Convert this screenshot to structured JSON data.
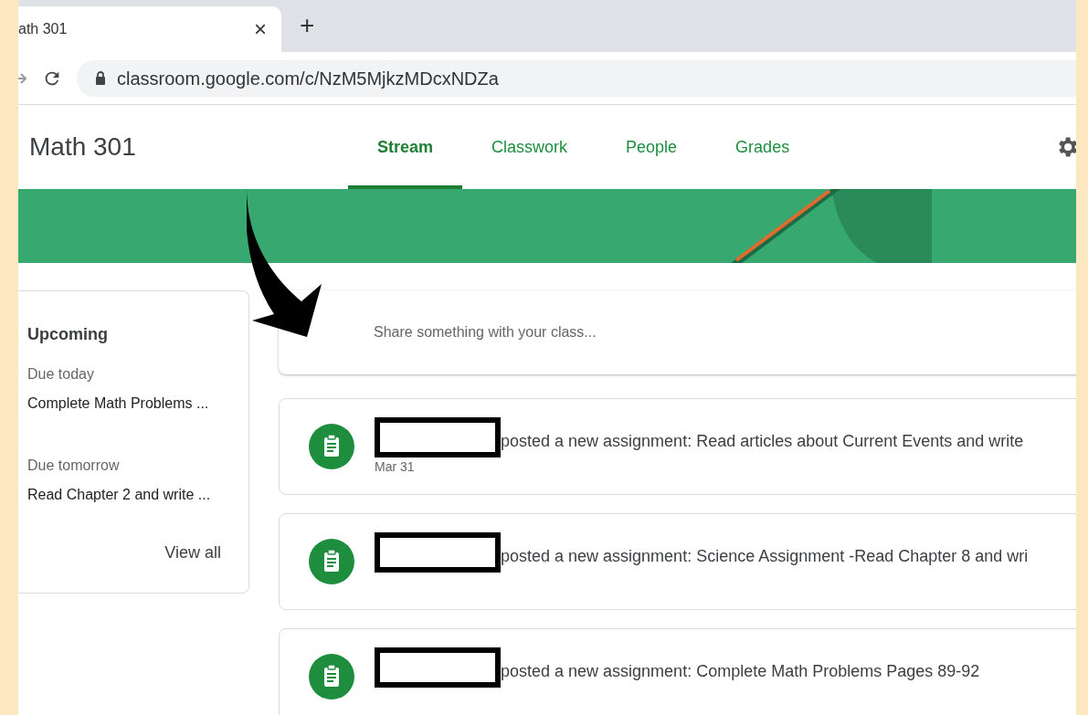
{
  "browser": {
    "tab_title": "ath 301",
    "tab_close": "×",
    "new_tab": "+",
    "url": "classroom.google.com/c/NzM5MjkzMDcxNDZa"
  },
  "header": {
    "class_name": "Math 301",
    "tabs": [
      {
        "label": "Stream",
        "selected": true
      },
      {
        "label": "Classwork",
        "selected": false
      },
      {
        "label": "People",
        "selected": false
      },
      {
        "label": "Grades",
        "selected": false
      }
    ]
  },
  "upcoming": {
    "title": "Upcoming",
    "items": [
      {
        "due": "Due today",
        "task": "Complete Math Problems ..."
      },
      {
        "due": "Due tomorrow",
        "task": "Read Chapter 2 and write ..."
      }
    ],
    "view_all": "View all"
  },
  "share": {
    "placeholder": "Share something with your class..."
  },
  "posts": [
    {
      "text": "posted a new assignment: Read articles about Current Events and write",
      "date": "Mar 31"
    },
    {
      "text": "posted a new assignment: Science Assignment -Read Chapter 8 and wri"
    },
    {
      "text": "posted a new assignment: Complete Math Problems Pages 89-92"
    }
  ]
}
